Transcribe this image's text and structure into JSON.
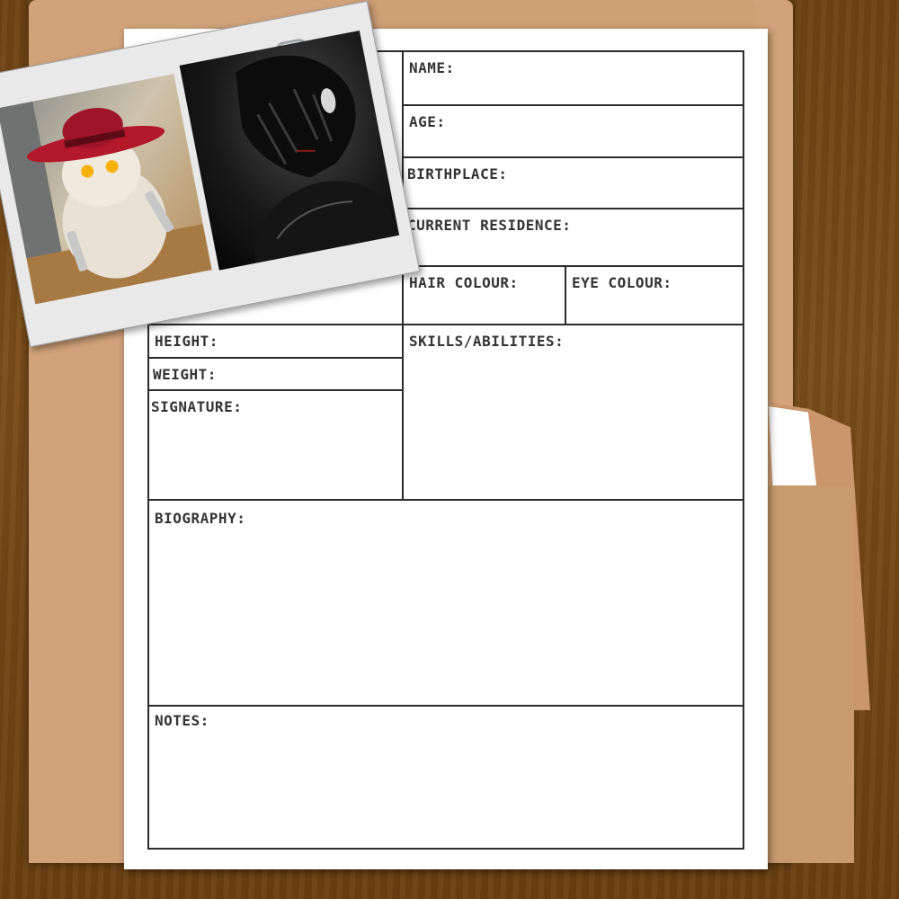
{
  "form": {
    "name_label": "NAME:",
    "age_label": "AGE:",
    "birthplace_label": "BIRTHPLACE:",
    "residence_label": "CURRENT RESIDENCE:",
    "hair_label": "HAIR COLOUR:",
    "eye_label": "EYE COLOUR:",
    "height_label": "HEIGHT:",
    "weight_label": "WEIGHT:",
    "signature_label": "SIGNATURE:",
    "skills_label": "SKILLS/ABILITIES:",
    "biography_label": "BIOGRAPHY:",
    "notes_label": "NOTES:"
  },
  "colors": {
    "wood": "#6e4314",
    "folder": "#d2a37a",
    "paper": "#ffffff",
    "ink": "#2b2b2b"
  },
  "photos": {
    "left": "cat-with-red-hat-and-guns",
    "right": "dark-anime-character"
  }
}
